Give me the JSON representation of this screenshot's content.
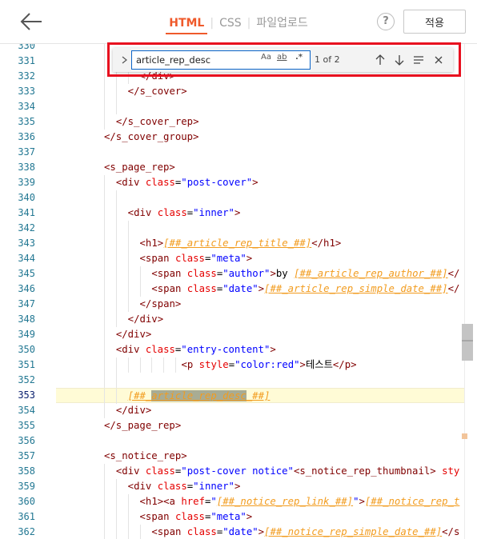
{
  "header": {
    "tabs": [
      "HTML",
      "CSS",
      "파일업로드"
    ],
    "active_tab": "HTML",
    "help_label": "?",
    "apply_label": "적용"
  },
  "find": {
    "query": "article_rep_desc",
    "match_case_label": "Aa",
    "whole_word_label": "ab",
    "regex_label": ".*",
    "count_label": "1 of 2"
  },
  "editor": {
    "current_line": "353",
    "lines": [
      {
        "n": "330",
        "indent": 1,
        "segs": []
      },
      {
        "n": "331",
        "indent": 1,
        "segs": []
      },
      {
        "n": "332",
        "indent": 6,
        "segs": [
          {
            "t": "</div>",
            "c": "tag"
          }
        ]
      },
      {
        "n": "333",
        "indent": 4,
        "segs": [
          {
            "t": "</s_cover>",
            "c": "tag"
          }
        ]
      },
      {
        "n": "334",
        "indent": 4,
        "segs": []
      },
      {
        "n": "335",
        "indent": 2,
        "segs": [
          {
            "t": "</s_cover_rep>",
            "c": "tag"
          }
        ]
      },
      {
        "n": "336",
        "indent": 0,
        "segs": [
          {
            "t": "</s_cover_group>",
            "c": "tag"
          }
        ]
      },
      {
        "n": "337",
        "indent": 0,
        "segs": []
      },
      {
        "n": "338",
        "indent": 0,
        "segs": [
          {
            "t": "<s_page_rep>",
            "c": "tag"
          }
        ]
      },
      {
        "n": "339",
        "indent": 2,
        "segs": [
          {
            "t": "<div ",
            "c": "tag"
          },
          {
            "t": "class",
            "c": "attr"
          },
          {
            "t": "=",
            "c": ""
          },
          {
            "t": "\"post-cover\"",
            "c": "val"
          },
          {
            "t": ">",
            "c": "tag"
          }
        ]
      },
      {
        "n": "340",
        "indent": 4,
        "segs": []
      },
      {
        "n": "341",
        "indent": 4,
        "segs": [
          {
            "t": "<div ",
            "c": "tag"
          },
          {
            "t": "class",
            "c": "attr"
          },
          {
            "t": "=",
            "c": ""
          },
          {
            "t": "\"inner\"",
            "c": "val"
          },
          {
            "t": ">",
            "c": "tag"
          }
        ]
      },
      {
        "n": "342",
        "indent": 6,
        "segs": []
      },
      {
        "n": "343",
        "indent": 6,
        "segs": [
          {
            "t": "<h1>",
            "c": "tag"
          },
          {
            "t": "[##_article_rep_title_##]",
            "c": "var u"
          },
          {
            "t": "</h1>",
            "c": "tag"
          }
        ]
      },
      {
        "n": "344",
        "indent": 6,
        "segs": [
          {
            "t": "<span ",
            "c": "tag"
          },
          {
            "t": "class",
            "c": "attr"
          },
          {
            "t": "=",
            "c": ""
          },
          {
            "t": "\"meta\"",
            "c": "val"
          },
          {
            "t": ">",
            "c": "tag"
          }
        ]
      },
      {
        "n": "345",
        "indent": 8,
        "segs": [
          {
            "t": "<span ",
            "c": "tag"
          },
          {
            "t": "class",
            "c": "attr"
          },
          {
            "t": "=",
            "c": ""
          },
          {
            "t": "\"author\"",
            "c": "val"
          },
          {
            "t": ">",
            "c": "tag"
          },
          {
            "t": "by ",
            "c": ""
          },
          {
            "t": "[##_article_rep_author_##]",
            "c": "var u"
          },
          {
            "t": "</",
            "c": "tag"
          }
        ]
      },
      {
        "n": "346",
        "indent": 8,
        "segs": [
          {
            "t": "<span ",
            "c": "tag"
          },
          {
            "t": "class",
            "c": "attr"
          },
          {
            "t": "=",
            "c": ""
          },
          {
            "t": "\"date\"",
            "c": "val"
          },
          {
            "t": ">",
            "c": "tag"
          },
          {
            "t": "[##_article_rep_simple_date_##]",
            "c": "var u"
          },
          {
            "t": "</",
            "c": "tag"
          }
        ]
      },
      {
        "n": "347",
        "indent": 6,
        "segs": [
          {
            "t": "</span>",
            "c": "tag"
          }
        ]
      },
      {
        "n": "348",
        "indent": 4,
        "segs": [
          {
            "t": "</div>",
            "c": "tag"
          }
        ]
      },
      {
        "n": "349",
        "indent": 2,
        "segs": [
          {
            "t": "</div>",
            "c": "tag"
          }
        ]
      },
      {
        "n": "350",
        "indent": 2,
        "segs": [
          {
            "t": "<div ",
            "c": "tag"
          },
          {
            "t": "class",
            "c": "attr"
          },
          {
            "t": "=",
            "c": ""
          },
          {
            "t": "\"entry-content\"",
            "c": "val"
          },
          {
            "t": ">",
            "c": "tag"
          }
        ]
      },
      {
        "n": "351",
        "indent": 13,
        "segs": [
          {
            "t": "<p ",
            "c": "tag"
          },
          {
            "t": "style",
            "c": "attr"
          },
          {
            "t": "=",
            "c": ""
          },
          {
            "t": "\"color:red\"",
            "c": "val"
          },
          {
            "t": ">",
            "c": "tag"
          },
          {
            "t": "테스트",
            "c": ""
          },
          {
            "t": "</p>",
            "c": "tag"
          }
        ]
      },
      {
        "n": "352",
        "indent": 4,
        "segs": []
      },
      {
        "n": "353",
        "indent": 4,
        "segs": [
          {
            "t": "[##_",
            "c": "var u"
          },
          {
            "t": "article_rep_desc",
            "c": "var u hl"
          },
          {
            "t": "_##]",
            "c": "var u"
          }
        ]
      },
      {
        "n": "354",
        "indent": 2,
        "segs": [
          {
            "t": "</div>",
            "c": "tag"
          }
        ]
      },
      {
        "n": "355",
        "indent": 0,
        "segs": [
          {
            "t": "</s_page_rep>",
            "c": "tag"
          }
        ]
      },
      {
        "n": "356",
        "indent": 0,
        "segs": []
      },
      {
        "n": "357",
        "indent": 0,
        "segs": [
          {
            "t": "<s_notice_rep>",
            "c": "tag"
          }
        ]
      },
      {
        "n": "358",
        "indent": 2,
        "segs": [
          {
            "t": "<div ",
            "c": "tag"
          },
          {
            "t": "class",
            "c": "attr"
          },
          {
            "t": "=",
            "c": ""
          },
          {
            "t": "\"post-cover notice\"",
            "c": "val"
          },
          {
            "t": "<s_notice_rep_thumbnail> ",
            "c": "tag"
          },
          {
            "t": "sty",
            "c": "attr"
          }
        ]
      },
      {
        "n": "359",
        "indent": 4,
        "segs": [
          {
            "t": "<div ",
            "c": "tag"
          },
          {
            "t": "class",
            "c": "attr"
          },
          {
            "t": "=",
            "c": ""
          },
          {
            "t": "\"inner\"",
            "c": "val"
          },
          {
            "t": ">",
            "c": "tag"
          }
        ]
      },
      {
        "n": "360",
        "indent": 6,
        "segs": [
          {
            "t": "<h1>",
            "c": "tag"
          },
          {
            "t": "<a ",
            "c": "tag"
          },
          {
            "t": "href",
            "c": "attr"
          },
          {
            "t": "=",
            "c": ""
          },
          {
            "t": "\"",
            "c": "val"
          },
          {
            "t": "[##_notice_rep_link_##]",
            "c": "var u"
          },
          {
            "t": "\"",
            "c": "val"
          },
          {
            "t": ">",
            "c": "tag"
          },
          {
            "t": "[##_notice_rep_t",
            "c": "var u"
          }
        ]
      },
      {
        "n": "361",
        "indent": 6,
        "segs": [
          {
            "t": "<span ",
            "c": "tag"
          },
          {
            "t": "class",
            "c": "attr"
          },
          {
            "t": "=",
            "c": ""
          },
          {
            "t": "\"meta\"",
            "c": "val"
          },
          {
            "t": ">",
            "c": "tag"
          }
        ]
      },
      {
        "n": "362",
        "indent": 8,
        "segs": [
          {
            "t": "<span ",
            "c": "tag"
          },
          {
            "t": "class",
            "c": "attr"
          },
          {
            "t": "=",
            "c": ""
          },
          {
            "t": "\"date\"",
            "c": "val"
          },
          {
            "t": ">",
            "c": "tag"
          },
          {
            "t": "[##_notice_rep_simple_date_##]",
            "c": "var u"
          },
          {
            "t": "</s",
            "c": "tag"
          }
        ]
      }
    ]
  }
}
